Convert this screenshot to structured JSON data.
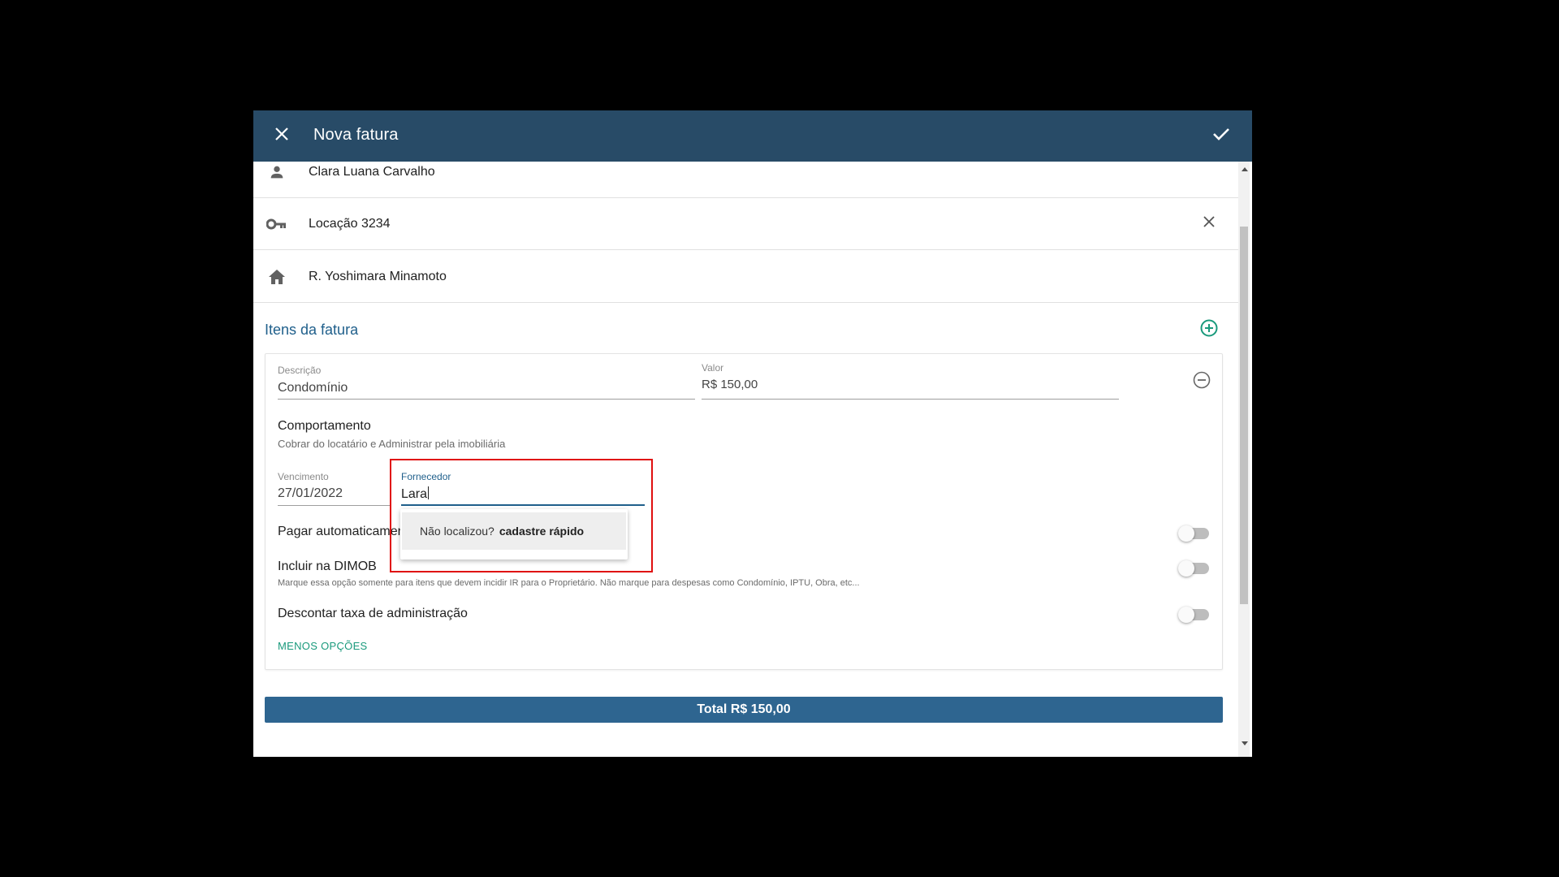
{
  "dialog": {
    "title": "Nova fatura"
  },
  "info": {
    "person": "Clara Luana Carvalho",
    "rental": "Locação 3234",
    "address": "R. Yoshimara Minamoto"
  },
  "items_section": {
    "title": "Itens da fatura"
  },
  "item": {
    "descricao_label": "Descrição",
    "descricao_value": "Condomínio",
    "valor_label": "Valor",
    "valor_value": "R$ 150,00",
    "comportamento_label": "Comportamento",
    "comportamento_value": "Cobrar do locatário e Administrar pela imobiliária",
    "vencimento_label": "Vencimento",
    "vencimento_value": "27/01/2022",
    "fornecedor_label": "Fornecedor",
    "fornecedor_value": "Lara"
  },
  "dropdown": {
    "question": "Não localizou?",
    "link": "cadastre rápido"
  },
  "options": {
    "pagar_auto_label": "Pagar automaticamen",
    "dimob_label": "Incluir na DIMOB",
    "dimob_help": "Marque essa opção somente para itens que devem incidir IR para o Proprietário. Não marque para despesas como Condomínio, IPTU, Obra, etc...",
    "desconto_label": "Descontar taxa de administração",
    "pagar_auto_on": false,
    "dimob_on": false,
    "desconto_on": false
  },
  "menos_opcoes": "MENOS OPÇÕES",
  "total": "Total R$ 150,00",
  "icons": {
    "close": "close-icon",
    "confirm": "check-icon",
    "person": "person-icon",
    "key": "key-icon",
    "home": "home-icon",
    "add": "add-circle-icon",
    "remove": "remove-circle-icon"
  },
  "colors": {
    "header": "#284b67",
    "accent_teal": "#1a9a7c",
    "section_blue": "#1f5f8b",
    "total_bar": "#2e6590",
    "highlight": "#e01010"
  }
}
